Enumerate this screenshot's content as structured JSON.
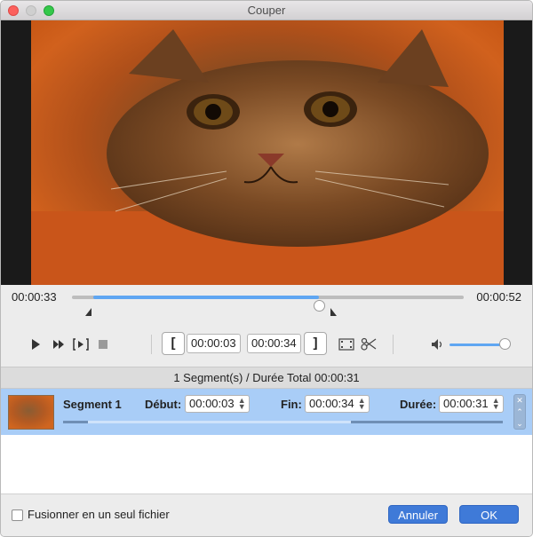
{
  "window": {
    "title": "Couper"
  },
  "playback": {
    "current_time": "00:00:33",
    "total_time": "00:00:52",
    "progress_fraction": 0.63
  },
  "toolbar": {
    "start_time": "00:00:03",
    "end_time": "00:00:34",
    "volume_fraction": 0.95
  },
  "summary": {
    "text": "1 Segment(s) / Durée Total 00:00:31"
  },
  "segments": [
    {
      "name": "Segment 1",
      "start_label": "Début:",
      "start": "00:00:03",
      "end_label": "Fin:",
      "end": "00:00:34",
      "duration_label": "Durée:",
      "duration": "00:00:31"
    }
  ],
  "footer": {
    "merge_label": "Fusionner en un seul fichier",
    "merge_checked": false,
    "cancel_label": "Annuler",
    "ok_label": "OK"
  },
  "colors": {
    "accent": "#5fa6f2",
    "selection": "#a9cdf7",
    "button": "#3f7ad8"
  }
}
